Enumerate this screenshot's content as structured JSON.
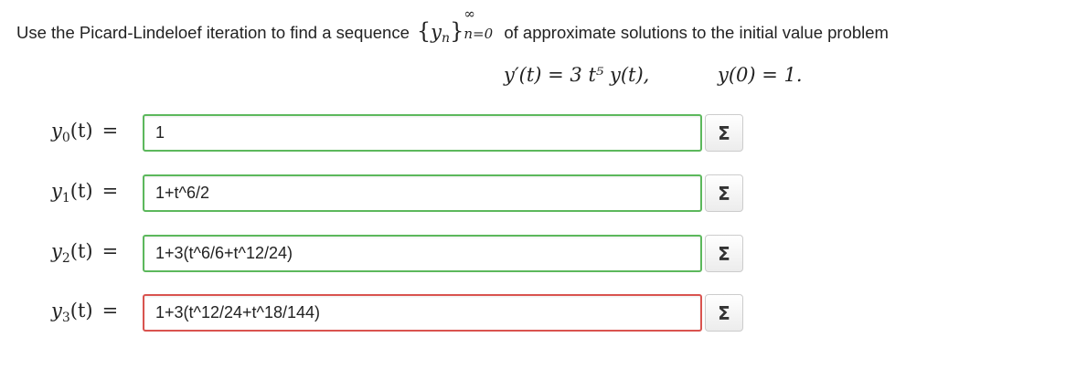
{
  "prompt": {
    "text_before": "Use the Picard-Lindeloef iteration to find a sequence",
    "seq_var": "y",
    "seq_sub": "n",
    "seq_sup": "∞",
    "seq_lower": "n=0",
    "text_after": "of approximate solutions to the initial value problem"
  },
  "equation": {
    "ode": "y′(t) = 3 t⁵ y(t),",
    "initial_condition": "y(0) = 1."
  },
  "rows": [
    {
      "var": "y",
      "sub": "0",
      "arg": "(t)",
      "eq": "=",
      "value": "1",
      "status": "correct"
    },
    {
      "var": "y",
      "sub": "1",
      "arg": "(t)",
      "eq": "=",
      "value": "1+t^6/2",
      "status": "correct"
    },
    {
      "var": "y",
      "sub": "2",
      "arg": "(t)",
      "eq": "=",
      "value": "1+3(t^6/6+t^12/24)",
      "status": "correct"
    },
    {
      "var": "y",
      "sub": "3",
      "arg": "(t)",
      "eq": "=",
      "value": "1+3(t^12/24+t^18/144)",
      "status": "incorrect"
    }
  ],
  "sigma_label": "Σ",
  "sigma_icon": "sigma-icon",
  "colors": {
    "correct_border": "#5cb85c",
    "incorrect_border": "#d9534f"
  }
}
